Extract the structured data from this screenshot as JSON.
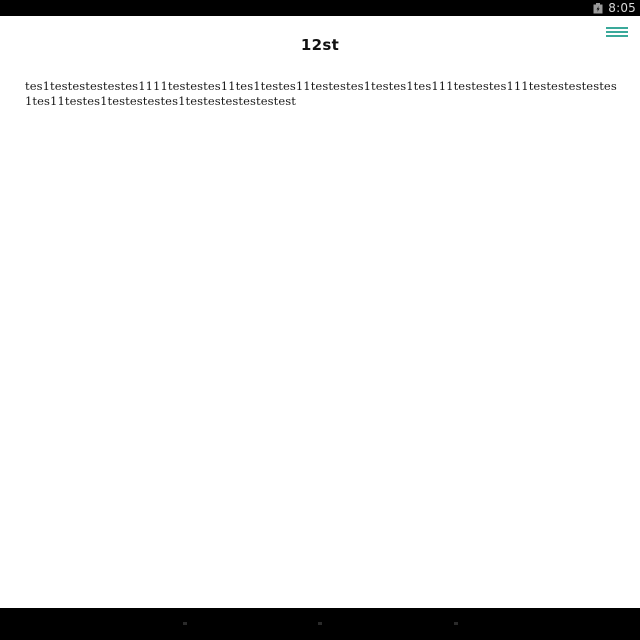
{
  "status_bar": {
    "time": "8:05",
    "icon": "battery-icon"
  },
  "header": {
    "title": "12st",
    "menu_icon": "hamburger-menu-icon",
    "accent_color": "#3aa99a"
  },
  "content": {
    "text": "tes1testestestestes1111testestes11tes1testes11testestes1testes1tes111testestes111testestestestes1tes11testes1testestestes1testestestestestest"
  },
  "nav_bar": {
    "back_icon": "back-icon",
    "home_icon": "home-icon",
    "recents_icon": "recents-icon"
  }
}
